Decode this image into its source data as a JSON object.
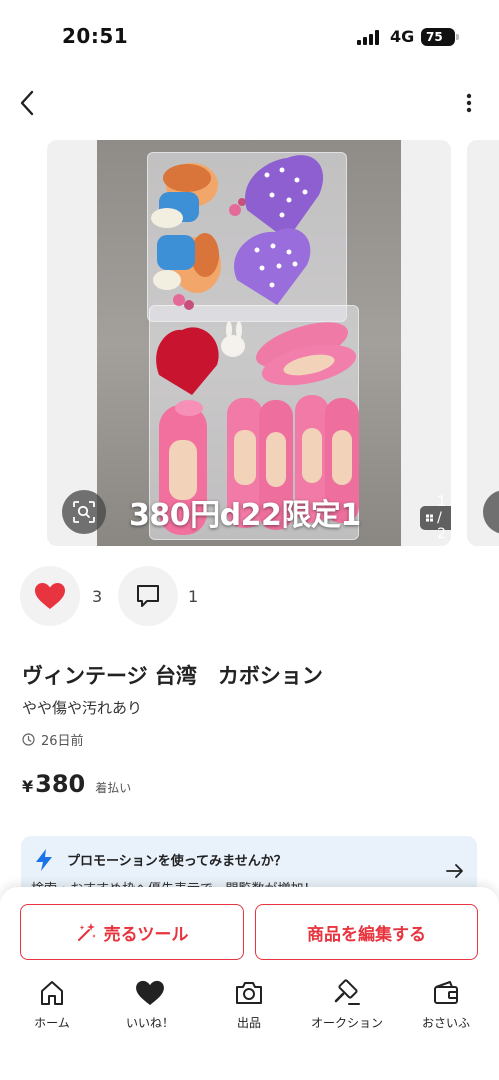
{
  "status_bar": {
    "time": "20:51",
    "network": "4G",
    "battery": "75"
  },
  "header": {
    "back_icon": "chevron-left-icon",
    "more_icon": "vertical-dots-icon"
  },
  "gallery": {
    "overlay_text": "380円d22限定1",
    "page_indicator": "1 / 2",
    "lens_icon": "image-search-icon"
  },
  "reactions": {
    "like_count": "3",
    "comment_count": "1",
    "like_icon": "heart-icon",
    "comment_icon": "comment-icon"
  },
  "item": {
    "title": "ヴィンテージ 台湾　カボション",
    "condition": "やや傷や汚れあり",
    "posted": "26日前",
    "price_currency": "¥",
    "price_value": "380",
    "shipping": "着払い"
  },
  "promo": {
    "title": "プロモーションを使ってみませんか？",
    "subtitle": "検索・おすすめ枠へ優先表示で、閲覧数が増加！"
  },
  "actions": {
    "sell_tool": "売るツール",
    "edit": "商品を編集する"
  },
  "tabs": [
    {
      "label": "ホーム",
      "icon": "home-icon"
    },
    {
      "label": "いいね！",
      "icon": "heart-icon"
    },
    {
      "label": "出品",
      "icon": "camera-icon"
    },
    {
      "label": "オークション",
      "icon": "gavel-icon"
    },
    {
      "label": "おさいふ",
      "icon": "wallet-icon"
    }
  ],
  "colors": {
    "accent": "#e8343e",
    "promo_bg": "#e9f1fa",
    "lightning": "#1a73e8"
  }
}
